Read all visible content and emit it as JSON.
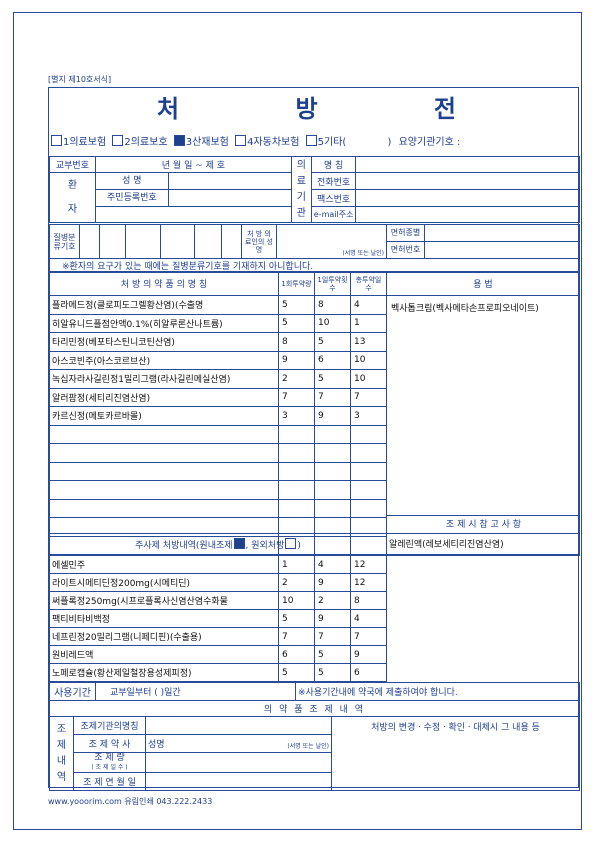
{
  "form_label": "[별지 제10호서식]",
  "title": "처 방 전",
  "insurance": {
    "options": [
      "1의료보험",
      "2의료보호",
      "3산재보험",
      "4자동차보험",
      "5기타("
    ],
    "other_close": ")",
    "institution_code": "요양기관기호 :"
  },
  "patient": {
    "issue_no": "교부번호",
    "date": "년  월  일 ~ 제       호",
    "patient_label_1": "환",
    "patient_label_2": "자",
    "name": "성      명",
    "resident_no": "주민등록번호"
  },
  "institution": {
    "label": [
      "의",
      "료",
      "기",
      "관"
    ],
    "name": "명   칭",
    "phone": "전화번호",
    "fax": "팩스번호",
    "email": "e-mail주소"
  },
  "disease": {
    "label": "질병분류기호",
    "doctor_label": "처 방 의료인의 성 명",
    "signature": "(서명 또는 날인)",
    "license_type": "면허종별",
    "license_no": "면허번호",
    "note": "※환자의 요구가 있는 때에는 질병분류기호를 기재하지 아니합니다."
  },
  "prescription": {
    "headers": {
      "name": "처 방 의 약 품 의 명 칭",
      "dose": "1회투약량",
      "freq": "1일투약횟수",
      "days": "총투약일수",
      "usage": "용        법"
    },
    "rows": [
      {
        "name": "플라메드정(클로피도그렐황산염)(수출명",
        "dose": "5",
        "freq": "8",
        "days": "4"
      },
      {
        "name": "히알유니드플점안액0.1%(히알루론산나트륨)",
        "dose": "5",
        "freq": "10",
        "days": "1"
      },
      {
        "name": "타리민정(베포타스틴니코틴산염)",
        "dose": "8",
        "freq": "5",
        "days": "13"
      },
      {
        "name": "아스코빈주(아스코르브산)",
        "dose": "9",
        "freq": "6",
        "days": "10"
      },
      {
        "name": "녹십자라사길린정1밀리그램(라사길린메실산염)",
        "dose": "2",
        "freq": "5",
        "days": "10"
      },
      {
        "name": "알러팜정(세티리진염산염)",
        "dose": "7",
        "freq": "7",
        "days": "7"
      },
      {
        "name": "카르신정(메토카르바몰)",
        "dose": "3",
        "freq": "9",
        "days": "3"
      }
    ],
    "usage_text": "벡사톱크림(벡사메타손프로피오네이트)",
    "reference_header": "조 제 시  참 고 사 항",
    "reference_text": "알레린액(레보세티리진염산염)"
  },
  "injection": {
    "header": "주사제 처방내역(원내조제",
    "header_mid": ", 원외처방",
    "header_end": ")",
    "rows": [
      {
        "name": "에셀민주",
        "dose": "1",
        "freq": "4",
        "days": "12"
      },
      {
        "name": "라이트시메티딘정200mg(시메티딘)",
        "dose": "2",
        "freq": "9",
        "days": "12"
      },
      {
        "name": "써플록정250mg(시프로플록사신염산염수화물",
        "dose": "10",
        "freq": "2",
        "days": "8"
      },
      {
        "name": "팩티비타비백정",
        "dose": "5",
        "freq": "9",
        "days": "4"
      },
      {
        "name": "네프린정20밀리그램(니페디핀)(수출용)",
        "dose": "7",
        "freq": "7",
        "days": "7"
      },
      {
        "name": "원비레드액",
        "dose": "6",
        "freq": "5",
        "days": "9"
      },
      {
        "name": "노페로캡슐(황산제일철장용성제피정)",
        "dose": "5",
        "freq": "5",
        "days": "6"
      }
    ]
  },
  "period": {
    "label": "사용기간",
    "text": "교부일부터  (             )일간",
    "note": "※사용기간내에 약국에 제출하여야 합니다."
  },
  "dispensing": {
    "header": "의 약 품 조 제 내 역",
    "side_label": [
      "조",
      "제",
      "내",
      "역"
    ],
    "institution": "조제기관의명칭",
    "pharmacist": "조 제 약 사",
    "name_label": "성명",
    "signature": "(서명 또는 날인)",
    "amount": "조   제   량",
    "amount_sub": "( 조 제 일 수 )",
    "date": "조 제 연 월 일",
    "changes": "처방의 변경ㆍ수정ㆍ확인ㆍ대체시 그 내용 등"
  },
  "footer": "www.yooorim.com 유림인쇄   043.222.2433"
}
